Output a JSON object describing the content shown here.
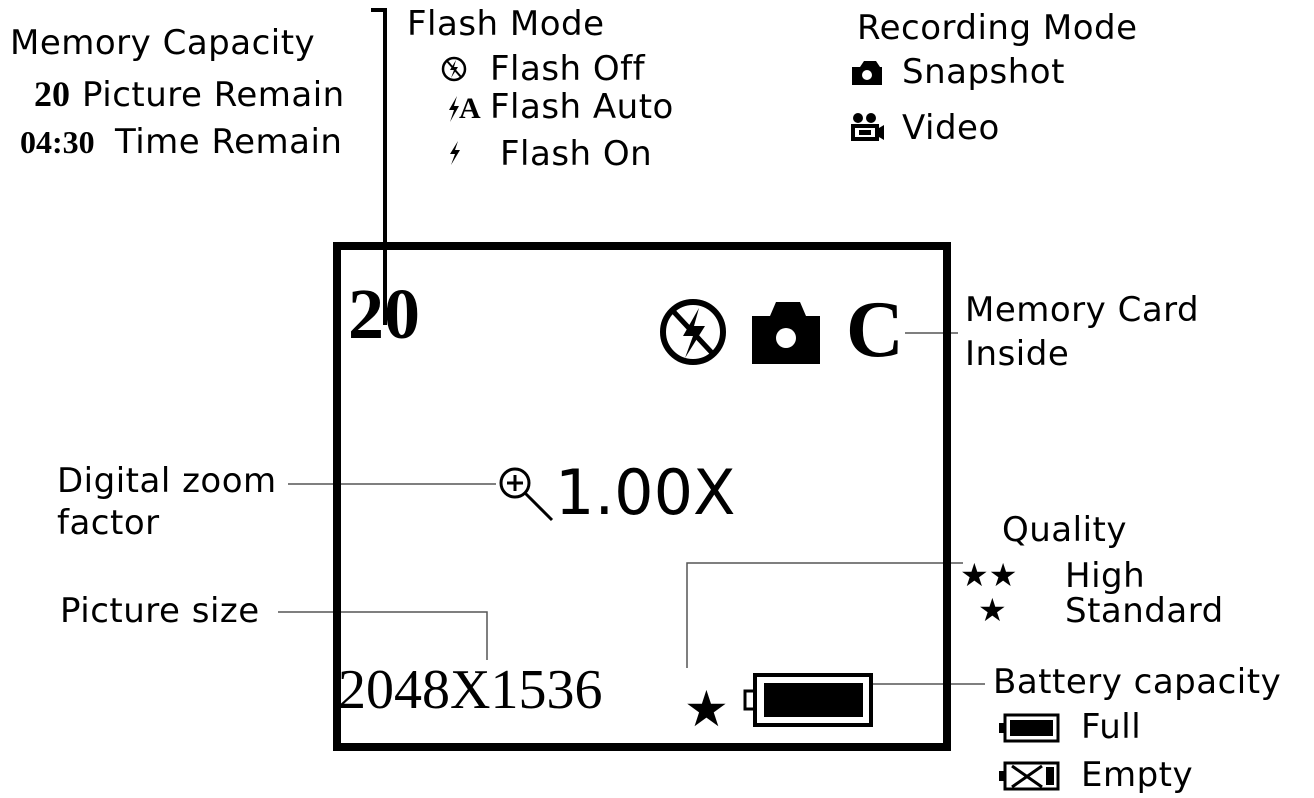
{
  "memory_capacity": {
    "heading": "Memory Capacity",
    "pictures_value": "20",
    "pictures_label": "Picture Remain",
    "time_value": "04:30",
    "time_label": "Time Remain"
  },
  "flash_mode": {
    "heading": "Flash Mode",
    "items": [
      {
        "icon": "flash-off-icon",
        "label": "Flash Off"
      },
      {
        "icon": "flash-auto-icon",
        "icon_text": "A",
        "label": "Flash Auto"
      },
      {
        "icon": "flash-on-icon",
        "label": "Flash On"
      }
    ]
  },
  "recording_mode": {
    "heading": "Recording Mode",
    "items": [
      {
        "icon": "camera-icon",
        "label": "Snapshot"
      },
      {
        "icon": "video-camera-icon",
        "label": "Video"
      }
    ]
  },
  "screen": {
    "remaining_count": "20",
    "memory_card_indicator": "C",
    "zoom": "1.00X",
    "picture_size": "2048X1536"
  },
  "callouts": {
    "memory_card": [
      "Memory Card",
      "Inside"
    ],
    "digital_zoom": [
      "Digital zoom",
      "factor"
    ],
    "picture_size": "Picture size"
  },
  "quality": {
    "heading": "Quality",
    "items": [
      {
        "stars": "★★",
        "label": "High"
      },
      {
        "stars": "★",
        "label": "Standard"
      }
    ]
  },
  "battery": {
    "heading": "Battery capacity",
    "items": [
      {
        "icon": "battery-full-icon",
        "label": "Full"
      },
      {
        "icon": "battery-empty-icon",
        "label": "Empty"
      }
    ]
  },
  "quality_star_on_screen": "★"
}
